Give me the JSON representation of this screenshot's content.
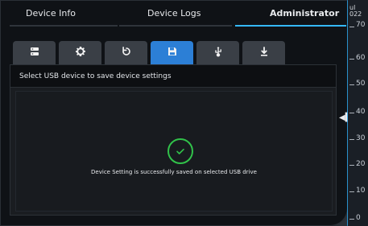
{
  "header": {
    "tabs": [
      {
        "label": "Device Info"
      },
      {
        "label": "Device Logs"
      },
      {
        "label": "Administrator"
      }
    ],
    "active_tab_index": 2
  },
  "toolbar": {
    "icons": [
      {
        "name": "server-icon"
      },
      {
        "name": "gear-icon"
      },
      {
        "name": "reset-icon"
      },
      {
        "name": "save-icon"
      },
      {
        "name": "usb-icon"
      },
      {
        "name": "download-icon"
      }
    ],
    "active_icon_index": 3
  },
  "content": {
    "instruction": "Select USB device to save device settings",
    "status_message": "Device Setting is successfully saved on selected USB drive"
  },
  "scale": {
    "top_fragment_1": "ul",
    "top_fragment_2": "022",
    "ticks": [
      "70",
      "60",
      "50",
      "40",
      "30",
      "20",
      "10",
      "0"
    ]
  },
  "colors": {
    "accent": "#35b8ff",
    "active_icon_tab": "#2c7fd6",
    "success": "#31c24a"
  }
}
